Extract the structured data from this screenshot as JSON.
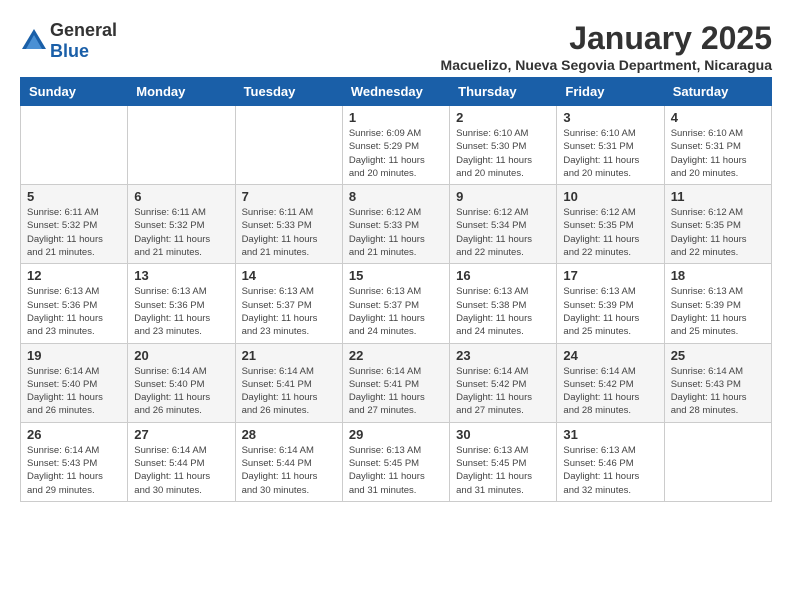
{
  "logo": {
    "general": "General",
    "blue": "Blue"
  },
  "title": "January 2025",
  "subtitle": "Macuelizo, Nueva Segovia Department, Nicaragua",
  "days_of_week": [
    "Sunday",
    "Monday",
    "Tuesday",
    "Wednesday",
    "Thursday",
    "Friday",
    "Saturday"
  ],
  "weeks": [
    [
      {
        "day": "",
        "sunrise": "",
        "sunset": "",
        "daylight": ""
      },
      {
        "day": "",
        "sunrise": "",
        "sunset": "",
        "daylight": ""
      },
      {
        "day": "",
        "sunrise": "",
        "sunset": "",
        "daylight": ""
      },
      {
        "day": "1",
        "sunrise": "Sunrise: 6:09 AM",
        "sunset": "Sunset: 5:29 PM",
        "daylight": "Daylight: 11 hours and 20 minutes."
      },
      {
        "day": "2",
        "sunrise": "Sunrise: 6:10 AM",
        "sunset": "Sunset: 5:30 PM",
        "daylight": "Daylight: 11 hours and 20 minutes."
      },
      {
        "day": "3",
        "sunrise": "Sunrise: 6:10 AM",
        "sunset": "Sunset: 5:31 PM",
        "daylight": "Daylight: 11 hours and 20 minutes."
      },
      {
        "day": "4",
        "sunrise": "Sunrise: 6:10 AM",
        "sunset": "Sunset: 5:31 PM",
        "daylight": "Daylight: 11 hours and 20 minutes."
      }
    ],
    [
      {
        "day": "5",
        "sunrise": "Sunrise: 6:11 AM",
        "sunset": "Sunset: 5:32 PM",
        "daylight": "Daylight: 11 hours and 21 minutes."
      },
      {
        "day": "6",
        "sunrise": "Sunrise: 6:11 AM",
        "sunset": "Sunset: 5:32 PM",
        "daylight": "Daylight: 11 hours and 21 minutes."
      },
      {
        "day": "7",
        "sunrise": "Sunrise: 6:11 AM",
        "sunset": "Sunset: 5:33 PM",
        "daylight": "Daylight: 11 hours and 21 minutes."
      },
      {
        "day": "8",
        "sunrise": "Sunrise: 6:12 AM",
        "sunset": "Sunset: 5:33 PM",
        "daylight": "Daylight: 11 hours and 21 minutes."
      },
      {
        "day": "9",
        "sunrise": "Sunrise: 6:12 AM",
        "sunset": "Sunset: 5:34 PM",
        "daylight": "Daylight: 11 hours and 22 minutes."
      },
      {
        "day": "10",
        "sunrise": "Sunrise: 6:12 AM",
        "sunset": "Sunset: 5:35 PM",
        "daylight": "Daylight: 11 hours and 22 minutes."
      },
      {
        "day": "11",
        "sunrise": "Sunrise: 6:12 AM",
        "sunset": "Sunset: 5:35 PM",
        "daylight": "Daylight: 11 hours and 22 minutes."
      }
    ],
    [
      {
        "day": "12",
        "sunrise": "Sunrise: 6:13 AM",
        "sunset": "Sunset: 5:36 PM",
        "daylight": "Daylight: 11 hours and 23 minutes."
      },
      {
        "day": "13",
        "sunrise": "Sunrise: 6:13 AM",
        "sunset": "Sunset: 5:36 PM",
        "daylight": "Daylight: 11 hours and 23 minutes."
      },
      {
        "day": "14",
        "sunrise": "Sunrise: 6:13 AM",
        "sunset": "Sunset: 5:37 PM",
        "daylight": "Daylight: 11 hours and 23 minutes."
      },
      {
        "day": "15",
        "sunrise": "Sunrise: 6:13 AM",
        "sunset": "Sunset: 5:37 PM",
        "daylight": "Daylight: 11 hours and 24 minutes."
      },
      {
        "day": "16",
        "sunrise": "Sunrise: 6:13 AM",
        "sunset": "Sunset: 5:38 PM",
        "daylight": "Daylight: 11 hours and 24 minutes."
      },
      {
        "day": "17",
        "sunrise": "Sunrise: 6:13 AM",
        "sunset": "Sunset: 5:39 PM",
        "daylight": "Daylight: 11 hours and 25 minutes."
      },
      {
        "day": "18",
        "sunrise": "Sunrise: 6:13 AM",
        "sunset": "Sunset: 5:39 PM",
        "daylight": "Daylight: 11 hours and 25 minutes."
      }
    ],
    [
      {
        "day": "19",
        "sunrise": "Sunrise: 6:14 AM",
        "sunset": "Sunset: 5:40 PM",
        "daylight": "Daylight: 11 hours and 26 minutes."
      },
      {
        "day": "20",
        "sunrise": "Sunrise: 6:14 AM",
        "sunset": "Sunset: 5:40 PM",
        "daylight": "Daylight: 11 hours and 26 minutes."
      },
      {
        "day": "21",
        "sunrise": "Sunrise: 6:14 AM",
        "sunset": "Sunset: 5:41 PM",
        "daylight": "Daylight: 11 hours and 26 minutes."
      },
      {
        "day": "22",
        "sunrise": "Sunrise: 6:14 AM",
        "sunset": "Sunset: 5:41 PM",
        "daylight": "Daylight: 11 hours and 27 minutes."
      },
      {
        "day": "23",
        "sunrise": "Sunrise: 6:14 AM",
        "sunset": "Sunset: 5:42 PM",
        "daylight": "Daylight: 11 hours and 27 minutes."
      },
      {
        "day": "24",
        "sunrise": "Sunrise: 6:14 AM",
        "sunset": "Sunset: 5:42 PM",
        "daylight": "Daylight: 11 hours and 28 minutes."
      },
      {
        "day": "25",
        "sunrise": "Sunrise: 6:14 AM",
        "sunset": "Sunset: 5:43 PM",
        "daylight": "Daylight: 11 hours and 28 minutes."
      }
    ],
    [
      {
        "day": "26",
        "sunrise": "Sunrise: 6:14 AM",
        "sunset": "Sunset: 5:43 PM",
        "daylight": "Daylight: 11 hours and 29 minutes."
      },
      {
        "day": "27",
        "sunrise": "Sunrise: 6:14 AM",
        "sunset": "Sunset: 5:44 PM",
        "daylight": "Daylight: 11 hours and 30 minutes."
      },
      {
        "day": "28",
        "sunrise": "Sunrise: 6:14 AM",
        "sunset": "Sunset: 5:44 PM",
        "daylight": "Daylight: 11 hours and 30 minutes."
      },
      {
        "day": "29",
        "sunrise": "Sunrise: 6:13 AM",
        "sunset": "Sunset: 5:45 PM",
        "daylight": "Daylight: 11 hours and 31 minutes."
      },
      {
        "day": "30",
        "sunrise": "Sunrise: 6:13 AM",
        "sunset": "Sunset: 5:45 PM",
        "daylight": "Daylight: 11 hours and 31 minutes."
      },
      {
        "day": "31",
        "sunrise": "Sunrise: 6:13 AM",
        "sunset": "Sunset: 5:46 PM",
        "daylight": "Daylight: 11 hours and 32 minutes."
      },
      {
        "day": "",
        "sunrise": "",
        "sunset": "",
        "daylight": ""
      }
    ]
  ]
}
